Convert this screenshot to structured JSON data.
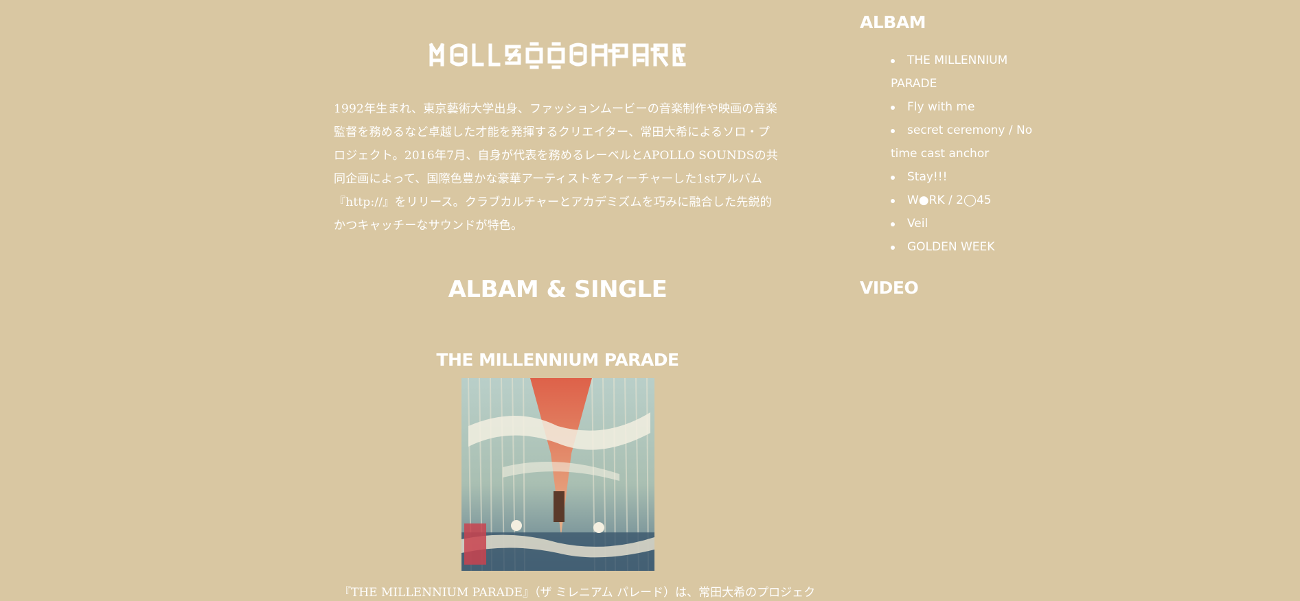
{
  "main": {
    "logo_text": "MILLENNIUM PARADE",
    "intro": "1992年生まれ、東京藝術大学出身、ファッションムービーの音楽制作や映画の音楽監督を務めるなど卓越した才能を発揮するクリエイター、常田大希によるソロ・プロジェクト。2016年7月、自身が代表を務めるレーベルとAPOLLO SOUNDSの共同企画によって、国際色豊かな豪華アーティストをフィーチャーした1stアルバム『http://』をリリース。クラブカルチャーとアカデミズムを巧みに融合した先鋭的かつキャッチーなサウンドが特色。",
    "section_title": "ALBAM & SINGLE",
    "album_title": "THE MILLENNIUM PARADE",
    "album_desc": "『THE MILLENNIUM PARADE』（ザ ミレニアム パレード）は、常田大希のプロジェク"
  },
  "sidebar": {
    "album_heading": "ALBAM",
    "items": [
      {
        "label": "THE MILLENNIUM PARADE"
      },
      {
        "label": "Fly with me"
      },
      {
        "label": "secret ceremony / No time cast anchor"
      },
      {
        "label": "Stay!!!"
      },
      {
        "label": "W●RK / 2◯45"
      },
      {
        "label": "Veil"
      },
      {
        "label": "GOLDEN WEEK"
      }
    ],
    "video_heading": "VIDEO"
  },
  "colors": {
    "background": "#d9c7a2",
    "text": "#ffffff"
  }
}
